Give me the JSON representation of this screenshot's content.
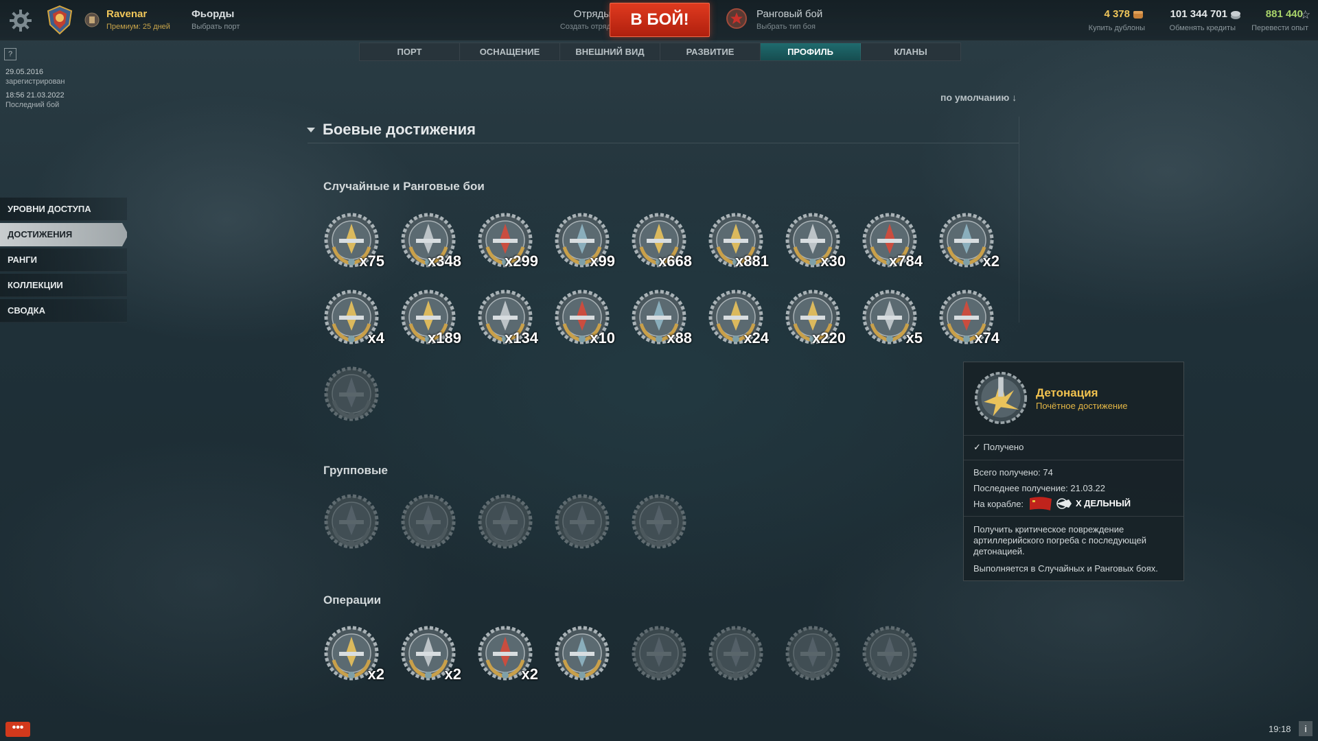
{
  "header": {
    "username": "Ravenar",
    "premium": "Премиум: 25 дней",
    "port": "Фьорды",
    "port_sub": "Выбрать порт",
    "divisions": "Отряды",
    "divisions_sub": "Создать отряд",
    "battle_button": "В БОЙ!",
    "battle_mode": "Ранговый бой",
    "battle_mode_sub": "Выбрать тип боя",
    "doubloons": "4 378",
    "doubloons_sub": "Купить дублоны",
    "credits": "101 344 701",
    "credits_sub": "Обменять кредиты",
    "free_xp": "881 440",
    "free_xp_sub": "Перевести опыт"
  },
  "nav_tabs": [
    "ПОРТ",
    "ОСНАЩЕНИЕ",
    "ВНЕШНИЙ ВИД",
    "РАЗВИТИЕ",
    "ПРОФИЛЬ",
    "КЛАНЫ"
  ],
  "nav_active": "ПРОФИЛЬ",
  "profile": {
    "help": "?",
    "reg_date": "29.05.2016",
    "reg_label": "зарегистрирован",
    "last_battle_date": "18:56  21.03.2022",
    "last_battle_label": "Последний бой"
  },
  "menu": [
    "УРОВНИ ДОСТУПА",
    "ДОСТИЖЕНИЯ",
    "РАНГИ",
    "КОЛЛЕКЦИИ",
    "СВОДКА"
  ],
  "menu_active": "ДОСТИЖЕНИЯ",
  "sort_label": "по умолчанию",
  "section_title": "Боевые достижения",
  "groups": [
    {
      "title": "Случайные и Ранговые бои",
      "medals": [
        {
          "icon": "anchor-medal-icon",
          "count": "x75",
          "earned": true
        },
        {
          "icon": "torpedo-medal-icon",
          "count": "x348",
          "earned": true
        },
        {
          "icon": "red-ribbon-medal-icon",
          "count": "x299",
          "earned": true
        },
        {
          "icon": "wave-medal-icon",
          "count": "x99",
          "earned": true
        },
        {
          "icon": "battleship-medal-icon",
          "count": "x668",
          "earned": true
        },
        {
          "icon": "explosion-medal-icon",
          "count": "x881",
          "earned": true
        },
        {
          "icon": "double-strike-medal-icon",
          "count": "x30",
          "earned": true
        },
        {
          "icon": "hourglass-medal-icon",
          "count": "x784",
          "earned": true
        },
        {
          "icon": "aa-gun-medal-icon",
          "count": "x2",
          "earned": true
        },
        {
          "icon": "crossed-shells-medal-icon",
          "count": "x4",
          "earned": true
        },
        {
          "icon": "turret-fire-medal-icon",
          "count": "x189",
          "earned": true
        },
        {
          "icon": "burning-ship-medal-icon",
          "count": "x134",
          "earned": true
        },
        {
          "icon": "splash-medal-icon",
          "count": "x10",
          "earned": true
        },
        {
          "icon": "flames-medal-icon",
          "count": "x88",
          "earned": true
        },
        {
          "icon": "anchor-wreath-medal-icon",
          "count": "x24",
          "earned": true
        },
        {
          "icon": "crossed-swords-medal-icon",
          "count": "x220",
          "earned": true
        },
        {
          "icon": "sinking-ship-medal-icon",
          "count": "x5",
          "earned": true
        },
        {
          "icon": "detonation-medal-icon",
          "count": "x74",
          "earned": true
        },
        {
          "icon": "bow-medal-icon",
          "count": "",
          "earned": false
        }
      ]
    },
    {
      "title": "Групповые",
      "medals": [
        {
          "icon": "kraken-medal-icon",
          "count": "",
          "earned": false
        },
        {
          "icon": "shield-torpedo-medal-icon",
          "count": "",
          "earned": false
        },
        {
          "icon": "sword-shield-medal-icon",
          "count": "",
          "earned": false
        },
        {
          "icon": "fist-shield-medal-icon",
          "count": "",
          "earned": false
        },
        {
          "icon": "pickaxe-shield-medal-icon",
          "count": "",
          "earned": false
        }
      ]
    },
    {
      "title": "Операции",
      "medals": [
        {
          "icon": "red-ribbon-op-medal-icon",
          "count": "x2",
          "earned": true
        },
        {
          "icon": "shield-op-medal-icon",
          "count": "x2",
          "earned": true
        },
        {
          "icon": "starfish-medal-icon",
          "count": "x2",
          "earned": true
        },
        {
          "icon": "tentacles-medal-icon",
          "count": "",
          "earned": true
        },
        {
          "icon": "guns-op-medal-icon",
          "count": "",
          "earned": false
        },
        {
          "icon": "cannon-op-medal-icon",
          "count": "",
          "earned": false
        },
        {
          "icon": "ring-op-medal-icon",
          "count": "",
          "earned": false
        },
        {
          "icon": "fox-op-medal-icon",
          "count": "",
          "earned": false
        }
      ]
    }
  ],
  "tooltip": {
    "title": "Детонация",
    "subtitle": "Почётное достижение",
    "status": "Получено",
    "total": "Всего получено: 74",
    "last": "Последнее получение: 21.03.22",
    "ship_label": "На корабле:",
    "ship_name": "X ДЕЛЬНЫЙ",
    "description": "Получить критическое повреждение артиллерийского погреба с последующей детонацией.",
    "modes": "Выполняется в Случайных и Ранговых боях."
  },
  "footer": {
    "chat": "•••",
    "clock": "19:18",
    "info": "i"
  },
  "colors": {
    "gold": "#f2c24f",
    "battle_red": "#d2391c",
    "active_tab": "#1f6b6e"
  }
}
